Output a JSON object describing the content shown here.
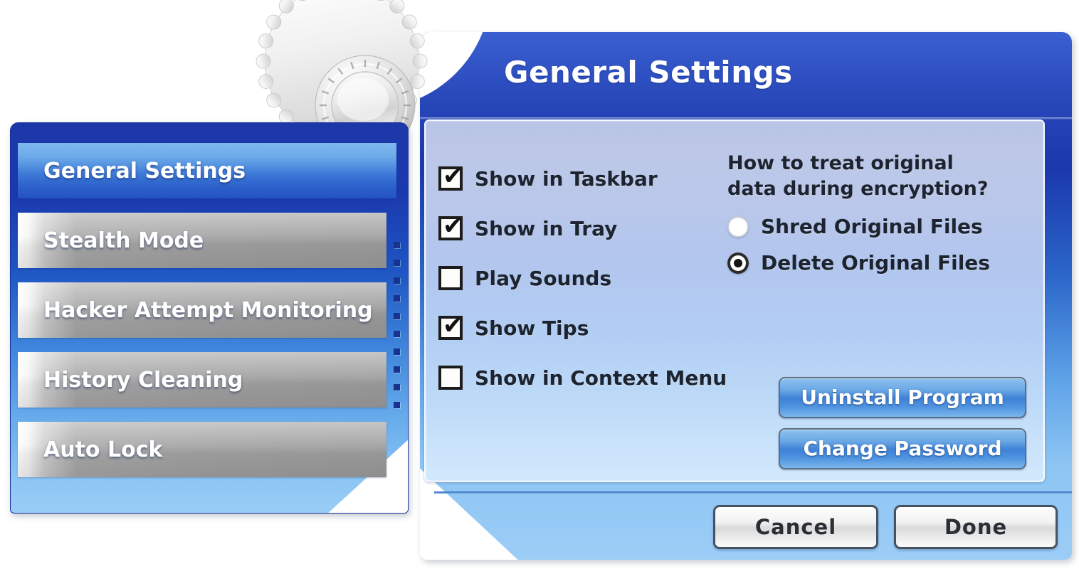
{
  "window": {
    "title": "General Settings"
  },
  "decor": {
    "gear_icon": "gear-cog-knob"
  },
  "sidebar": {
    "items": [
      {
        "label": "General Settings",
        "state": "active"
      },
      {
        "label": "Stealth Mode",
        "state": "inactive"
      },
      {
        "label": "Hacker Attempt Monitoring",
        "state": "inactive"
      },
      {
        "label": "History Cleaning",
        "state": "inactive"
      },
      {
        "label": "Auto Lock",
        "state": "inactive"
      }
    ]
  },
  "content": {
    "checkboxes": [
      {
        "label": "Show in Taskbar",
        "checked": true
      },
      {
        "label": "Show in Tray",
        "checked": true
      },
      {
        "label": "Play Sounds",
        "checked": false
      },
      {
        "label": "Show Tips",
        "checked": true
      },
      {
        "label": "Show in Context Menu",
        "checked": false
      }
    ],
    "radio_group": {
      "question": "How to treat original data during encryption?",
      "question_line1": "How to treat original",
      "question_line2": "data during encryption?",
      "options": [
        {
          "label": "Shred Original Files",
          "selected": false
        },
        {
          "label": "Delete Original Files",
          "selected": true
        }
      ]
    },
    "action_buttons": [
      {
        "label": "Uninstall Program"
      },
      {
        "label": "Change Password"
      }
    ]
  },
  "footer": {
    "cancel_label": "Cancel",
    "done_label": "Done"
  },
  "colors": {
    "header_blue": "#1b38ad",
    "accent_blue": "#3f81d6",
    "panel_light": "#b9c4e6",
    "nav_gray": "#a3a3a3",
    "dot_blue": "#17338f",
    "button_silver": "#f2f2f2"
  },
  "checkmark_glyph": "✔"
}
